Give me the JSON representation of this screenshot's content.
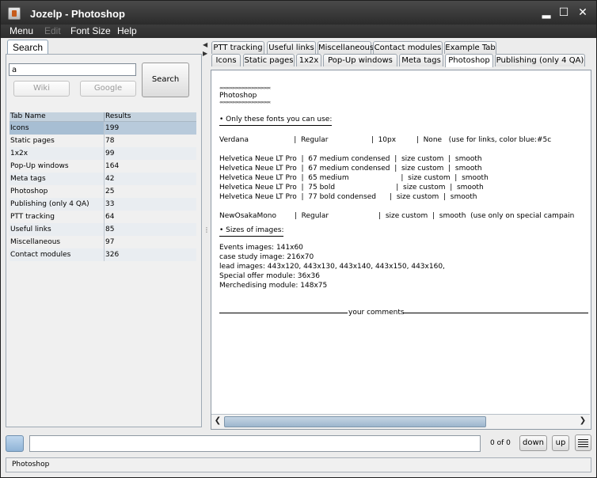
{
  "window": {
    "title": "Jozelp - Photoshop"
  },
  "window_controls": {
    "minimize": "▂",
    "maximize": "☐",
    "close": "✕"
  },
  "menu": {
    "items": [
      "Menu",
      "Edit",
      "Font Size",
      "Help"
    ]
  },
  "left": {
    "tab_label": "Search",
    "search_value": "a",
    "wiki_label": "Wiki",
    "google_label": "Google",
    "search_button": "Search",
    "table": {
      "headers": [
        "Tab Name",
        "Results"
      ],
      "rows": [
        [
          "Icons",
          "199"
        ],
        [
          "Static pages",
          "78"
        ],
        [
          "1x2x",
          "99"
        ],
        [
          "Pop-Up windows",
          "164"
        ],
        [
          "Meta tags",
          "42"
        ],
        [
          "Photoshop",
          "25"
        ],
        [
          "Publishing (only 4 QA)",
          "33"
        ],
        [
          "PTT tracking",
          "64"
        ],
        [
          "Useful links",
          "85"
        ],
        [
          "Miscellaneous",
          "97"
        ],
        [
          "Contact modules",
          "326"
        ]
      ]
    }
  },
  "tabs": {
    "row1": [
      "PTT tracking",
      "Useful links",
      "Miscellaneous",
      "Contact modules",
      "Example Tab"
    ],
    "row2": [
      "Icons",
      "Static pages",
      "1x2x",
      "Pop-Up windows",
      "Meta tags",
      "Photoshop",
      "Publishing (only 4 QA)"
    ],
    "active": "Photoshop"
  },
  "doc": {
    "ornament": "««««««««««««««««««««««««",
    "title": "Photoshop",
    "fonts_heading": "• Only these fonts you can use:",
    "font_lines": [
      "Verdana                    |  Regular                   |  10px         |  None   (use for links, color blue:#5c",
      "",
      "Helvetica Neue LT Pro  |  67 medium condensed  |  size custom  |  smooth",
      "Helvetica Neue LT Pro  |  67 medium condensed  |  size custom  |  smooth",
      "Helvetica Neue LT Pro  |  65 medium                       |  size custom  |  smooth",
      "Helvetica Neue LT Pro  |  75 bold                           |  size custom  |  smooth",
      "Helvetica Neue LT Pro  |  77 bold condensed      |  size custom  |  smooth",
      "",
      "NewOsakaMono        |  Regular                      |  size custom  |  smooth  (use only on special campain"
    ],
    "sizes_heading": "• Sizes of images:",
    "size_lines": [
      "Events images: 141x60",
      "case study image: 216x70",
      "lead images: 443x120, 443x130, 443x140, 443x150, 443x160,",
      "Special offer module: 36x36",
      "Merchedising module: 148x75"
    ],
    "comments_label": "your comments"
  },
  "find": {
    "count": "0 of 0",
    "down_label": "down",
    "up_label": "up"
  },
  "status": {
    "text": "Photoshop"
  }
}
